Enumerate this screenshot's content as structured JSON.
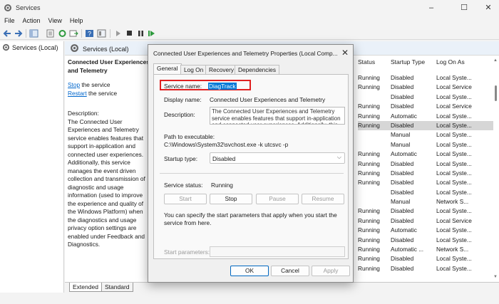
{
  "window": {
    "title": "Services",
    "controls": {
      "minimize": "–",
      "maximize": "☐",
      "close": "✕"
    }
  },
  "menu": [
    "File",
    "Action",
    "View",
    "Help"
  ],
  "toolbar_icons": [
    "back-arrow-icon",
    "forward-arrow-icon",
    "console-tree-icon",
    "properties-list-icon",
    "refresh-icon",
    "export-icon",
    "help-icon",
    "snapin-icon",
    "play-icon",
    "stop-icon",
    "pause-icon",
    "restart-icon"
  ],
  "tree": {
    "root_label": "Services (Local)"
  },
  "pane": {
    "header_label": "Services (Local)",
    "selected_service_title": "Connected User Experiences and Telemetry",
    "stop_link": "Stop",
    "stop_suffix": " the service",
    "restart_link": "Restart",
    "restart_suffix": " the service",
    "description_label": "Description:",
    "description_text": "The Connected User Experiences and Telemetry service enables features that support in-application and connected user experiences. Additionally, this service manages the event driven collection and transmission of diagnostic and usage information (used to improve the experience and quality of the Windows Platform) when the diagnostics and usage privacy option settings are enabled under Feedback and Diagnostics."
  },
  "columns": {
    "status": "Status",
    "startup": "Startup Type",
    "logon": "Log On As"
  },
  "rows": [
    {
      "status": "Running",
      "startup": "Disabled",
      "logon": "Local Syste..."
    },
    {
      "status": "Running",
      "startup": "Disabled",
      "logon": "Local Service"
    },
    {
      "status": "",
      "startup": "Disabled",
      "logon": "Local Syste..."
    },
    {
      "status": "Running",
      "startup": "Disabled",
      "logon": "Local Service"
    },
    {
      "status": "Running",
      "startup": "Automatic",
      "logon": "Local Syste..."
    },
    {
      "status": "Running",
      "startup": "Disabled",
      "logon": "Local Syste...",
      "selected": true
    },
    {
      "status": "",
      "startup": "Manual",
      "logon": "Local Syste..."
    },
    {
      "status": "",
      "startup": "Manual",
      "logon": "Local Syste..."
    },
    {
      "status": "Running",
      "startup": "Automatic",
      "logon": "Local Syste..."
    },
    {
      "status": "Running",
      "startup": "Disabled",
      "logon": "Local Syste..."
    },
    {
      "status": "Running",
      "startup": "Disabled",
      "logon": "Local Syste..."
    },
    {
      "status": "Running",
      "startup": "Disabled",
      "logon": "Local Syste..."
    },
    {
      "status": "",
      "startup": "Disabled",
      "logon": "Local Syste..."
    },
    {
      "status": "",
      "startup": "Manual",
      "logon": "Network S..."
    },
    {
      "status": "Running",
      "startup": "Disabled",
      "logon": "Local Syste..."
    },
    {
      "status": "Running",
      "startup": "Disabled",
      "logon": "Local Service"
    },
    {
      "status": "Running",
      "startup": "Automatic",
      "logon": "Local Syste..."
    },
    {
      "status": "Running",
      "startup": "Disabled",
      "logon": "Local Syste..."
    },
    {
      "status": "Running",
      "startup": "Automatic ...",
      "logon": "Network S..."
    },
    {
      "status": "Running",
      "startup": "Disabled",
      "logon": "Local Syste..."
    },
    {
      "status": "Running",
      "startup": "Disabled",
      "logon": "Local Syste..."
    }
  ],
  "bottom_tabs": [
    "Extended",
    "Standard"
  ],
  "dialog": {
    "title": "Connected User Experiences and Telemetry Properties (Local Comp...",
    "close": "✕",
    "tabs": [
      "General",
      "Log On",
      "Recovery",
      "Dependencies"
    ],
    "service_name_label": "Service name:",
    "service_name_value": "DiagTrack",
    "display_name_label": "Display name:",
    "display_name_value": "Connected User Experiences and Telemetry",
    "description_label": "Description:",
    "description_value": "The Connected User Experiences and Telemetry service enables features that support in-application and connected user experiences. Additionally, this",
    "path_label": "Path to executable:",
    "path_value": "C:\\Windows\\System32\\svchost.exe -k utcsvc -p",
    "startup_type_label": "Startup type:",
    "startup_type_value": "Disabled",
    "service_status_label": "Service status:",
    "service_status_value": "Running",
    "start_btn": "Start",
    "stop_btn": "Stop",
    "pause_btn": "Pause",
    "resume_btn": "Resume",
    "params_hint": "You can specify the start parameters that apply when you start the service from here.",
    "params_label": "Start parameters:",
    "ok_btn": "OK",
    "cancel_btn": "Cancel",
    "apply_btn": "Apply"
  },
  "colors": {
    "accent": "#0078d7",
    "highlight_box": "#e02020",
    "link": "#0066cc"
  }
}
